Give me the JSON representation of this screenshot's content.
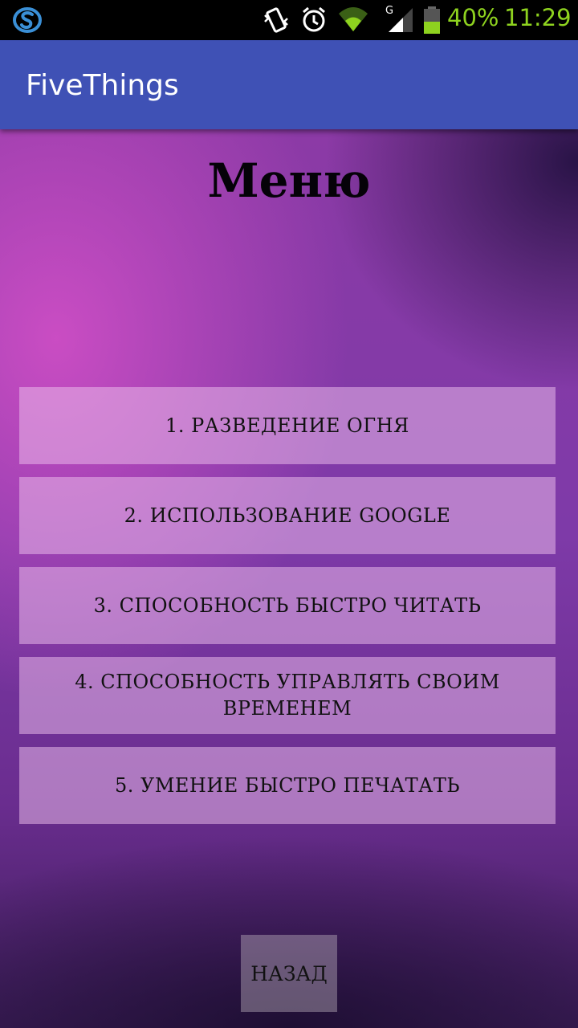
{
  "status_bar": {
    "battery_percent": "40%",
    "time": "11:29",
    "network_type": "G",
    "icons": [
      "sync-app-icon",
      "vibrate-icon",
      "alarm-icon",
      "wifi-icon",
      "signal-icon",
      "battery-icon"
    ],
    "accent_color": "#8ed21f"
  },
  "app_bar": {
    "title": "FiveThings",
    "color": "#3f51b5"
  },
  "content": {
    "heading": "Меню",
    "items": [
      {
        "label": "1. РАЗВЕДЕНИЕ ОГНЯ"
      },
      {
        "label": "2. ИСПОЛЬЗОВАНИЕ GOOGLE"
      },
      {
        "label": "3. СПОСОБНОСТЬ БЫСТРО ЧИТАТЬ"
      },
      {
        "label": "4. СПОСОБНОСТЬ УПРАВЛЯТЬ СВОИМ ВРЕМЕНЕМ"
      },
      {
        "label": "5. УМЕНИЕ БЫСТРО ПЕЧАТАТЬ"
      }
    ],
    "back_label": "НАЗАД"
  }
}
